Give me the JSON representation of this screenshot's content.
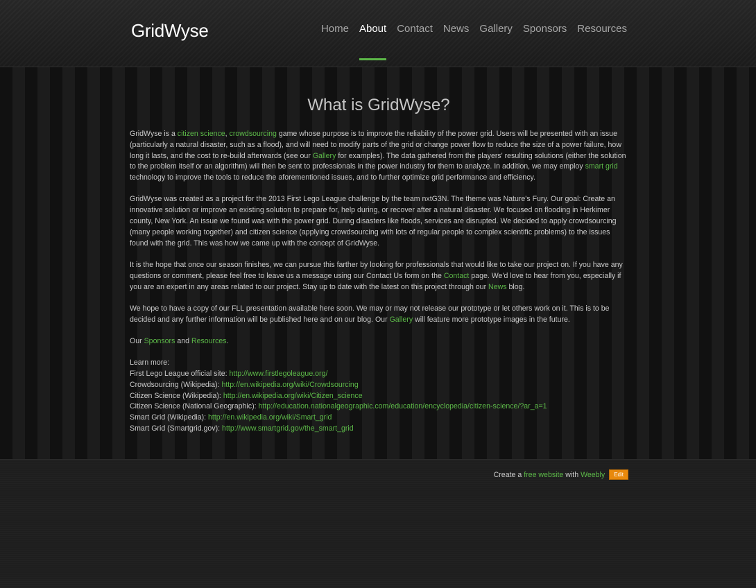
{
  "header": {
    "logo": "GridWyse",
    "nav": [
      "Home",
      "About",
      "Contact",
      "News",
      "Gallery",
      "Sponsors",
      "Resources"
    ],
    "active": "About"
  },
  "main": {
    "title": "What is GridWyse?",
    "p1": {
      "a": "GridWyse is a ",
      "link1": "citizen science",
      "b": ", ",
      "link2": "crowdsourcing",
      "c": " game whose purpose is to improve the reliability of the power grid. Users will be presented with an issue (particularly a natural disaster, such as a flood), and will need to modify parts of the grid or change power flow to reduce the size of a power failure, how long it lasts, and the cost to re-build afterwards (see our ",
      "link3": "Gallery",
      "d": " for examples). The data gathered from the players' resulting solutions (either the solution to the problem itself or an algorithm) will then be sent to professionals in the power industry for them to analyze. In addition, we may employ ",
      "link4": "smart grid",
      "e": " technology to improve the tools to reduce the aforementioned issues, and to further optimize grid performance and efficiency."
    },
    "p2": "GridWyse was created as a project for the 2013 First Lego League challenge by the team nxtG3N. The theme was Nature's Fury. Our goal: Create an innovative solution or improve an existing solution to prepare for, help during, or recover after a natural disaster. We focused on flooding in Herkimer county, New York. An issue we found was with the power grid. During disasters like floods, services are disrupted. We decided to apply crowdsourcing (many people working together) and citizen science (applying crowdsourcing with lots of regular people to complex scientific problems) to the issues found with the grid. This was how we came up with the concept of GridWyse.",
    "p3": {
      "a": "It is the hope that once our season finishes, we can pursue this farther by looking for professionals that would like to take our project on. If you have any questions or comment, please feel free to leave us a message using our Contact Us form on the ",
      "link1": "Contact",
      "b": " page. We'd love to hear from you, especially if you are an expert in any areas related to our project. Stay up to date with the latest on this project through our ",
      "link2": "News",
      "c": " blog."
    },
    "p4": {
      "a": "We hope to have a copy of our FLL presentation available here soon. We may or may not release our prototype or let others work on it. This is to be decided and any further information will be published here and on our blog. Our ",
      "link1": "Gallery",
      "b": " will feature more prototype images in the future."
    },
    "p5": {
      "a": "Our ",
      "link1": "Sponsors",
      "b": " and ",
      "link2": "Resources",
      "c": "."
    },
    "learn_more": "Learn more:",
    "links": [
      {
        "label": "First Lego League official site: ",
        "url": "http://www.firstlegoleague.org/"
      },
      {
        "label": "Crowdsourcing (Wikipedia): ",
        "url": "http://en.wikipedia.org/wiki/Crowdsourcing"
      },
      {
        "label": "Citizen Science (Wikipedia): ",
        "url": "http://en.wikipedia.org/wiki/Citizen_science"
      },
      {
        "label": "Citizen Science (National Geographic): ",
        "url": "http://education.nationalgeographic.com/education/encyclopedia/citizen-science/?ar_a=1"
      },
      {
        "label": "Smart Grid (Wikipedia): ",
        "url": "http://en.wikipedia.org/wiki/Smart_grid"
      },
      {
        "label": "Smart Grid (Smartgrid.gov): ",
        "url": "http://www.smartgrid.gov/the_smart_grid"
      }
    ]
  },
  "footer": {
    "a": "Create a ",
    "link1": "free website",
    "b": " with ",
    "link2": "Weebly",
    "edit": "Edit"
  },
  "colors": {
    "accent": "#5cb848",
    "edit_button": "#e8890c"
  }
}
